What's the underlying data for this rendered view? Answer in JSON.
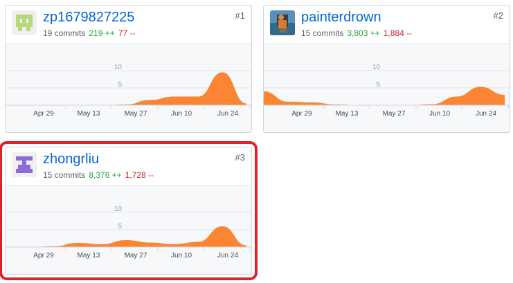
{
  "colors": {
    "accent": "#fb8532",
    "link": "#0366d6",
    "additions": "#28a745",
    "deletions": "#cb2431",
    "highlight": "#e0202a"
  },
  "x_axis_labels": [
    "Apr 29",
    "May 13",
    "May 27",
    "Jun 10",
    "Jun 24"
  ],
  "y_axis_labels": [
    "10",
    "5"
  ],
  "contributors": [
    {
      "rank": "#1",
      "username": "zp1679827225",
      "commits": "19 commits",
      "additions": "219 ++",
      "deletions": "77 --",
      "avatar_icon": "identicon-green-icon",
      "highlighted": false
    },
    {
      "rank": "#2",
      "username": "painterdrown",
      "commits": "15 commits",
      "additions": "3,803 ++",
      "deletions": "1,884 --",
      "avatar_icon": "photo-avatar-icon",
      "highlighted": false
    },
    {
      "rank": "#3",
      "username": "zhongrliu",
      "commits": "15 commits",
      "additions": "8,376 ++",
      "deletions": "1,728 --",
      "avatar_icon": "identicon-purple-icon",
      "highlighted": true
    }
  ],
  "chart_data": [
    {
      "type": "area",
      "x": [
        "Apr 22",
        "Apr 29",
        "May 6",
        "May 13",
        "May 20",
        "May 27",
        "Jun 3",
        "Jun 10",
        "Jun 17",
        "Jun 24",
        "Jul 1"
      ],
      "values": [
        0,
        0,
        0,
        0,
        0,
        0.2,
        1.5,
        2.5,
        2.5,
        9.5,
        0.5
      ],
      "ylim": [
        0,
        11
      ],
      "ytick_labels": [
        "10",
        "5"
      ],
      "xtick_labels": [
        "Apr 29",
        "May 13",
        "May 27",
        "Jun 10",
        "Jun 24"
      ]
    },
    {
      "type": "area",
      "x": [
        "Apr 22",
        "Apr 29",
        "May 6",
        "May 13",
        "May 20",
        "May 27",
        "Jun 3",
        "Jun 10",
        "Jun 17",
        "Jun 24",
        "Jul 1"
      ],
      "values": [
        4,
        1,
        0.8,
        0.2,
        0,
        0,
        0,
        0.3,
        2.5,
        5.3,
        3
      ],
      "ylim": [
        0,
        11
      ],
      "ytick_labels": [
        "10",
        "5"
      ],
      "xtick_labels": [
        "Apr 29",
        "May 13",
        "May 27",
        "Jun 10",
        "Jun 24"
      ]
    },
    {
      "type": "area",
      "x": [
        "Apr 22",
        "Apr 29",
        "May 6",
        "May 13",
        "May 20",
        "May 27",
        "Jun 3",
        "Jun 10",
        "Jun 17",
        "Jun 24",
        "Jul 1"
      ],
      "values": [
        0,
        0,
        0.2,
        1.2,
        0.8,
        2.0,
        1.3,
        0.8,
        1.5,
        6.0,
        0.5
      ],
      "ylim": [
        0,
        11
      ],
      "ytick_labels": [
        "10",
        "5"
      ],
      "xtick_labels": [
        "Apr 29",
        "May 13",
        "May 27",
        "Jun 10",
        "Jun 24"
      ]
    }
  ]
}
